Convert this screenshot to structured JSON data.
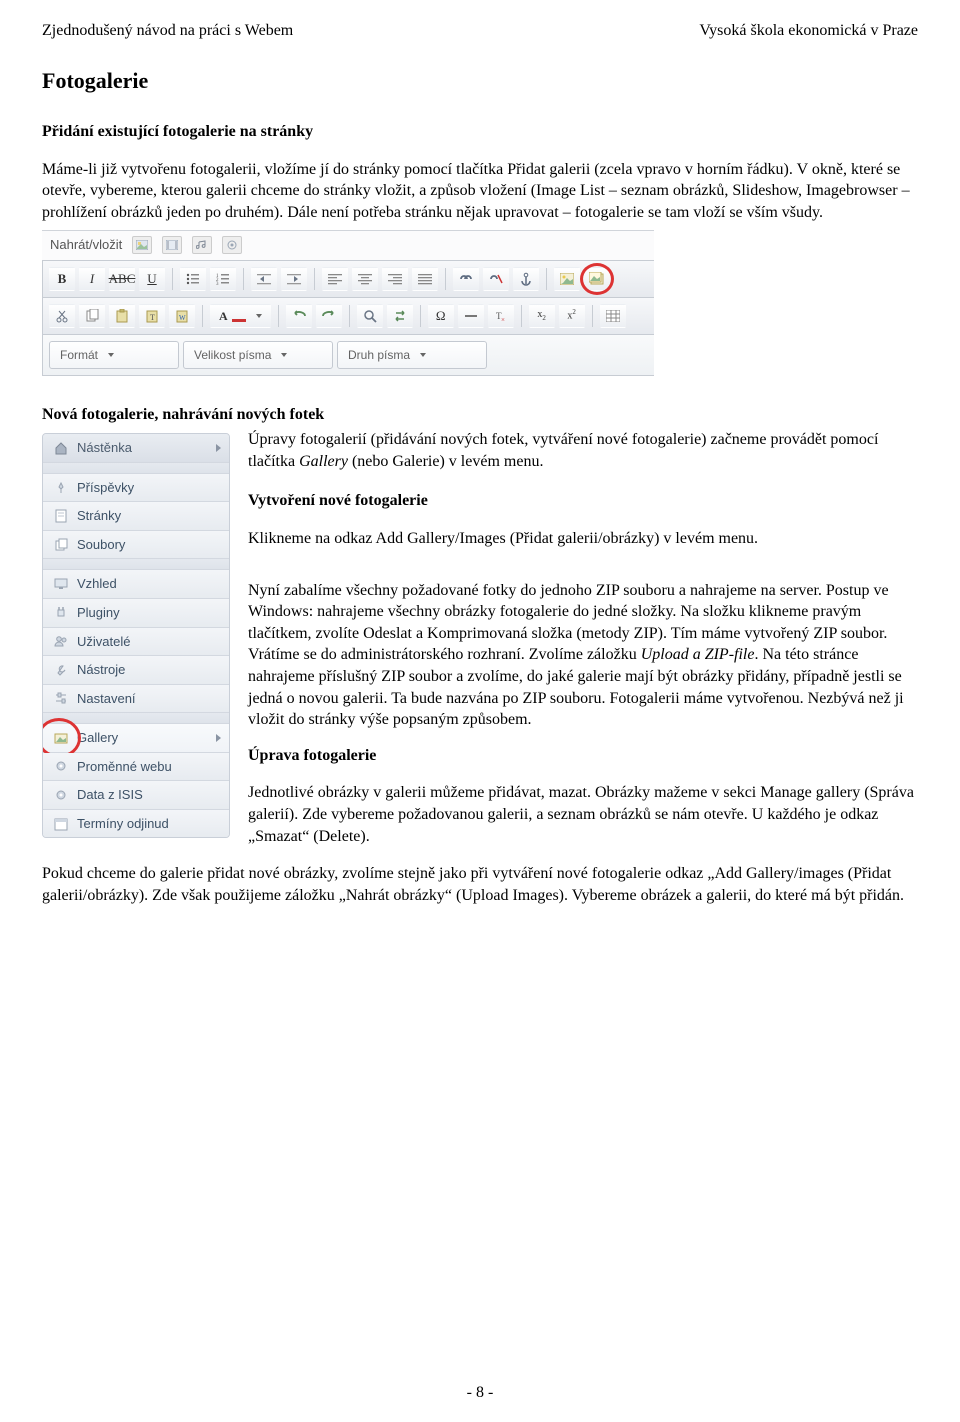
{
  "header": {
    "left": "Zjednodušený návod na práci s Webem",
    "right": "Vysoká škola ekonomická v Praze"
  },
  "h_fotogalerie": "Fotogalerie",
  "sec1": {
    "title": "Přidání existující fotogalerie na stránky",
    "body": "Máme-li již vytvořenu fotogalerii, vložíme jí do stránky pomocí tlačítka Přidat galerii (zcela vpravo v horním řádku). V okně, které se otevře, vybereme, kterou galerii chceme do stránky vložit, a způsob vložení (Image List – seznam obrázků, Slideshow, Imagebrowser – prohlížení obrázků jeden po druhém). Dále není potřeba stránku nějak upravovat – fotogalerie se tam vloží se vším všudy."
  },
  "toolbar": {
    "title": "Nahrát/vložit",
    "format_label": "Formát",
    "fontsize_label": "Velikost písma",
    "fontfamily_label": "Druh písma"
  },
  "sec2": {
    "title": "Nová fotogalerie, nahrávání nových fotek",
    "intro_a": "Úpravy fotogalerií (přidávání nových fotek, vytváření nové fotogalerie) začneme provádět pomocí tlačítka ",
    "intro_italic": "Gallery",
    "intro_b": " (nebo Galerie) v levém menu."
  },
  "sec3": {
    "title": "Vytvoření nové fotogalerie",
    "p1": "Klikneme na odkaz Add Gallery/Images (Přidat galerii/obrázky) v levém menu.",
    "p2_a": "Nyní zabalíme všechny požadované fotky do jednoho ZIP souboru a nahrajeme na server. Postup ve Windows: nahrajeme všechny obrázky fotogalerie do jedné složky. Na složku klikneme pravým tlačítkem, zvolíte Odeslat a Komprimovaná složka (metody ZIP). Tím máme vytvořený ZIP soubor. Vrátíme se do administrátorského rozhraní. Zvolíme záložku ",
    "p2_italic": "Upload a ZIP-file",
    "p2_b": ". Na této stránce nahrajeme příslušný ZIP soubor a zvolíme, do jaké galerie mají být obrázky přidány, případně jestli se jedná o novou galerii. Ta bude nazvána po ZIP souboru. Fotogalerii máme vytvořenou. Nezbývá než ji vložit do stránky výše popsaným způsobem."
  },
  "sec4": {
    "title": "Úprava fotogalerie",
    "p1": "Jednotlivé obrázky v galerii můžeme přidávat, mazat. Obrázky mažeme v sekci Manage gallery (Správa galerií). Zde vybereme požadovanou galerii, a seznam obrázků se nám otevře. U každého je odkaz „Smazat“ (Delete).",
    "p2": "Pokud chceme do galerie přidat nové obrázky, zvolíme stejně jako při vytváření nové fotogalerie odkaz „Add Gallery/images (Přidat galerii/obrázky). Zde však použijeme záložku „Nahrát obrázky“ (Upload Images). Vybereme obrázek a galerii, do které má být přidán."
  },
  "sidebar": {
    "items": [
      "Nástěnka",
      "Příspěvky",
      "Stránky",
      "Soubory",
      "Vzhled",
      "Pluginy",
      "Uživatelé",
      "Nástroje",
      "Nastavení",
      "Gallery",
      "Proměnné webu",
      "Data z ISIS",
      "Termíny odjinud"
    ]
  },
  "page_number": "- 8 -"
}
